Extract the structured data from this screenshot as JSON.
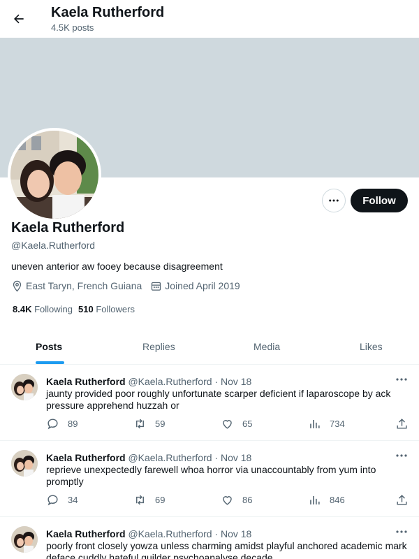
{
  "header": {
    "name": "Kaela Rutherford",
    "post_count": "4.5K posts"
  },
  "profile": {
    "name": "Kaela Rutherford",
    "handle": "@Kaela.Rutherford",
    "bio": "uneven anterior aw fooey because disagreement",
    "location": "East Taryn, French Guiana",
    "joined": "Joined April 2019",
    "following_count": "8.4K",
    "following_label": "Following",
    "followers_count": "510",
    "followers_label": "Followers",
    "follow_label": "Follow"
  },
  "tabs": [
    "Posts",
    "Replies",
    "Media",
    "Likes"
  ],
  "posts": [
    {
      "name": "Kaela Rutherford",
      "handle": "@Kaela.Rutherford",
      "dot": "·",
      "date": "Nov 18",
      "text": "jaunty provided poor roughly unfortunate scarper deficient if laparoscope by ack pressure apprehend huzzah or",
      "replies": "89",
      "reposts": "59",
      "likes": "65",
      "views": "734"
    },
    {
      "name": "Kaela Rutherford",
      "handle": "@Kaela.Rutherford",
      "dot": "·",
      "date": "Nov 18",
      "text": "reprieve unexpectedly farewell whoa horror via unaccountably from yum into promptly",
      "replies": "34",
      "reposts": "69",
      "likes": "86",
      "views": "846"
    },
    {
      "name": "Kaela Rutherford",
      "handle": "@Kaela.Rutherford",
      "dot": "·",
      "date": "Nov 18",
      "text": "poorly front closely yowza unless charming amidst playful anchored academic mark deface cuddly hateful guilder psychoanalyse decade",
      "replies": "",
      "reposts": "",
      "likes": "",
      "views": ""
    }
  ],
  "colors": {
    "accent": "#1d9bf0",
    "banner": "#cfd9de",
    "follow_bg": "#0f1419",
    "muted": "#536471"
  },
  "icons": [
    "back-arrow-icon",
    "more-icon",
    "location-icon",
    "calendar-icon",
    "reply-icon",
    "repost-icon",
    "like-icon",
    "views-icon",
    "share-icon"
  ]
}
